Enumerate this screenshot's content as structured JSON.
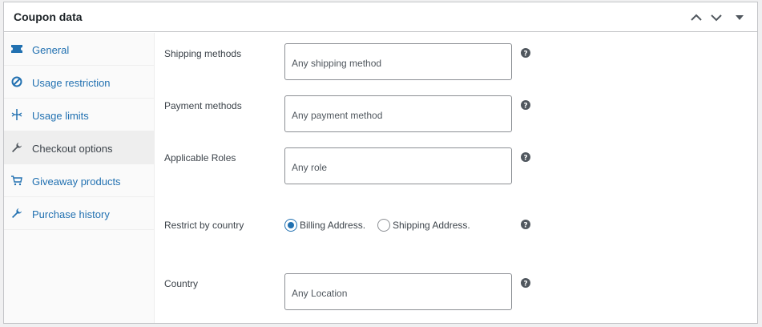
{
  "panel": {
    "title": "Coupon data",
    "controls": [
      {
        "name": "collapse-up",
        "icon": "chevron-up-icon"
      },
      {
        "name": "collapse-down",
        "icon": "chevron-down-icon"
      },
      {
        "name": "toggle-panel",
        "icon": "caret-down-icon"
      }
    ]
  },
  "sidebar": {
    "tabs": [
      {
        "label": "General",
        "icon": "ticket-icon",
        "active": false
      },
      {
        "label": "Usage restriction",
        "icon": "no-entry-icon",
        "active": false
      },
      {
        "label": "Usage limits",
        "icon": "limits-icon",
        "active": false
      },
      {
        "label": "Checkout options",
        "icon": "wrench-icon",
        "active": true
      },
      {
        "label": "Giveaway products",
        "icon": "cart-icon",
        "active": false
      },
      {
        "label": "Purchase history",
        "icon": "wrench-icon",
        "active": false
      }
    ]
  },
  "fields": {
    "shipping_methods": {
      "label": "Shipping methods",
      "placeholder": "Any shipping method"
    },
    "payment_methods": {
      "label": "Payment methods",
      "placeholder": "Any payment method"
    },
    "applicable_roles": {
      "label": "Applicable Roles",
      "placeholder": "Any role"
    },
    "restrict_by_country": {
      "label": "Restrict by country",
      "options": [
        {
          "label": "Billing Address.",
          "checked": true
        },
        {
          "label": "Shipping Address.",
          "checked": false
        }
      ]
    },
    "country": {
      "label": "Country",
      "placeholder": "Any Location"
    }
  },
  "help_icon": "help-icon",
  "colors": {
    "link": "#2271b1",
    "text": "#3c434a",
    "active_tab_bg": "#eeeeee",
    "sidebar_bg": "#fafafa",
    "border": "#c3c4c7"
  }
}
